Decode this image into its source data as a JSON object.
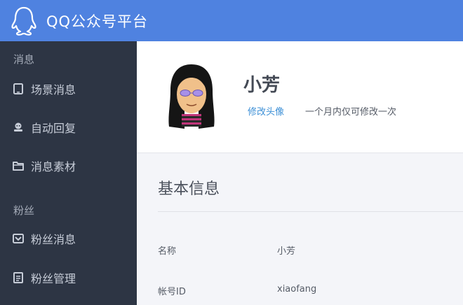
{
  "header": {
    "brand": "QQ公众号平台"
  },
  "sidebar": {
    "sections": [
      {
        "title": "消息",
        "items": [
          {
            "label": "场景消息",
            "icon": "tablet-icon"
          },
          {
            "label": "自动回复",
            "icon": "robot-icon"
          },
          {
            "label": "消息素材",
            "icon": "folder-icon"
          }
        ]
      },
      {
        "title": "粉丝",
        "items": [
          {
            "label": "粉丝消息",
            "icon": "inbox-icon"
          },
          {
            "label": "粉丝管理",
            "icon": "document-list-icon"
          }
        ]
      }
    ]
  },
  "profile": {
    "name": "小芳",
    "change_avatar_link": "修改头像",
    "change_note": "一个月内仅可修改一次"
  },
  "basic_info": {
    "title": "基本信息",
    "rows": [
      {
        "label": "名称",
        "value": "小芳"
      },
      {
        "label": "帐号ID",
        "value": "xiaofang"
      }
    ]
  },
  "colors": {
    "topbar": "#4f82e0",
    "sidebar": "#2d3544",
    "link": "#3b8fd6"
  }
}
